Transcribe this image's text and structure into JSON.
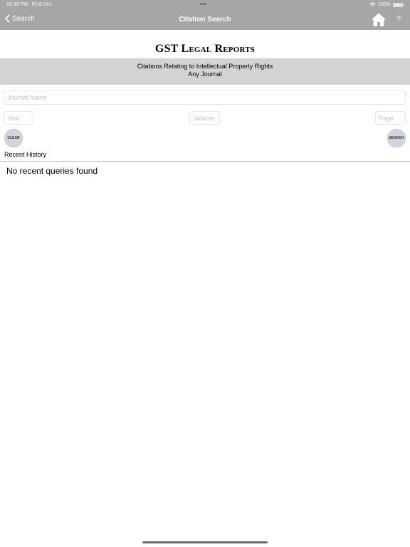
{
  "status_bar": {
    "time": "10:33 PM",
    "date": "Fri 8 Dec",
    "dots": "•••",
    "battery": "100%"
  },
  "nav": {
    "back_label": "Search",
    "title": "Citation Search",
    "help_label": "?"
  },
  "logo": {
    "text": "GST Legal Reports"
  },
  "banner": {
    "line1": "Citations Relating to Intellectual Property Rights",
    "line2": "Any Journal"
  },
  "form": {
    "journal_placeholder": "Journal Name",
    "year_placeholder": "Year",
    "volume_placeholder": "Volume",
    "page_placeholder": "Page",
    "clear_label": "CLEAR",
    "search_label": "SEARCH"
  },
  "history": {
    "title": "Recent History",
    "empty_message": "No recent queries found"
  },
  "colors": {
    "nav_background": "#a6a6a6",
    "banner_background": "#d3d3d3",
    "button_background": "#d0d6dc"
  }
}
